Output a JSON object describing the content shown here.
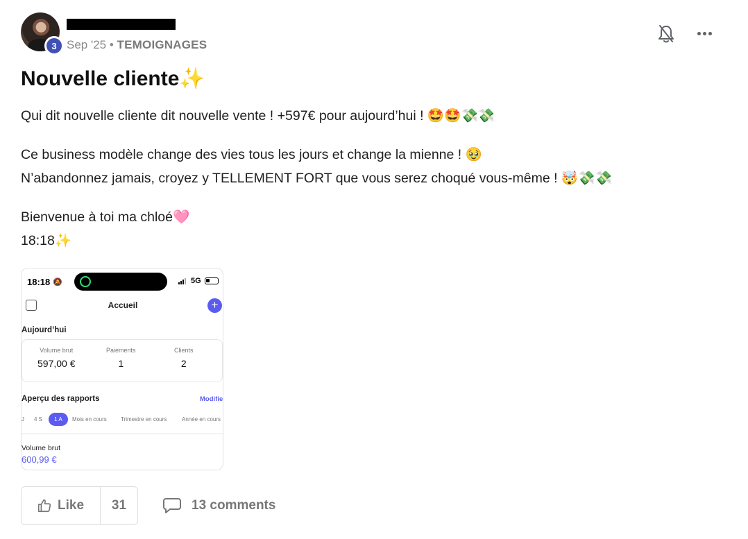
{
  "post": {
    "author": {
      "level": "3"
    },
    "date": "Sep '25",
    "separator": " • ",
    "category": "TEMOIGNAGES",
    "title": "Nouvelle cliente✨",
    "paragraphs": {
      "p1": "Qui dit nouvelle cliente dit nouvelle vente ! +597€ pour aujourd’hui ! 🤩🤩💸💸",
      "p2_line1": "Ce business modèle change des vies tous les jours et change la mienne ! 🥹",
      "p2_line2": "N’abandonnez jamais, croyez y TELLEMENT FORT que vous serez choqué vous-même ! 🤯💸💸",
      "p3_line1": "Bienvenue à toi ma chloé🩷",
      "p3_line2": "18:18✨"
    },
    "attachment": {
      "status_time": "18:18",
      "network": "5G",
      "screen_title": "Accueil",
      "add_symbol": "+",
      "section_today": "Aujourd’hui",
      "stats": {
        "gross_label": "Volume brut",
        "gross_value": "597,00 €",
        "payments_label": "Paiements",
        "payments_value": "1",
        "clients_label": "Clients",
        "clients_value": "2"
      },
      "reports_title": "Aperçu des rapports",
      "modify_label": "Modifier",
      "periods": {
        "p0": "J",
        "p1": "4 S",
        "p2": "1 A",
        "p3": "Mois en cours",
        "p4": "Trimestre en cours",
        "p5": "Année en cours"
      },
      "volume_label": "Volume brut",
      "volume_value": "600,99 €"
    },
    "actions": {
      "like_label": "Like",
      "like_count": "31",
      "comments_label": "13 comments"
    }
  },
  "colors": {
    "accent": "#5b5bf0",
    "level_badge": "#3f51b5",
    "muted_text": "#777777"
  },
  "icons": {
    "bell": "bell-off-icon",
    "more": "more-horizontal-icon",
    "like": "thumbs-up-icon",
    "comment": "comment-icon"
  }
}
